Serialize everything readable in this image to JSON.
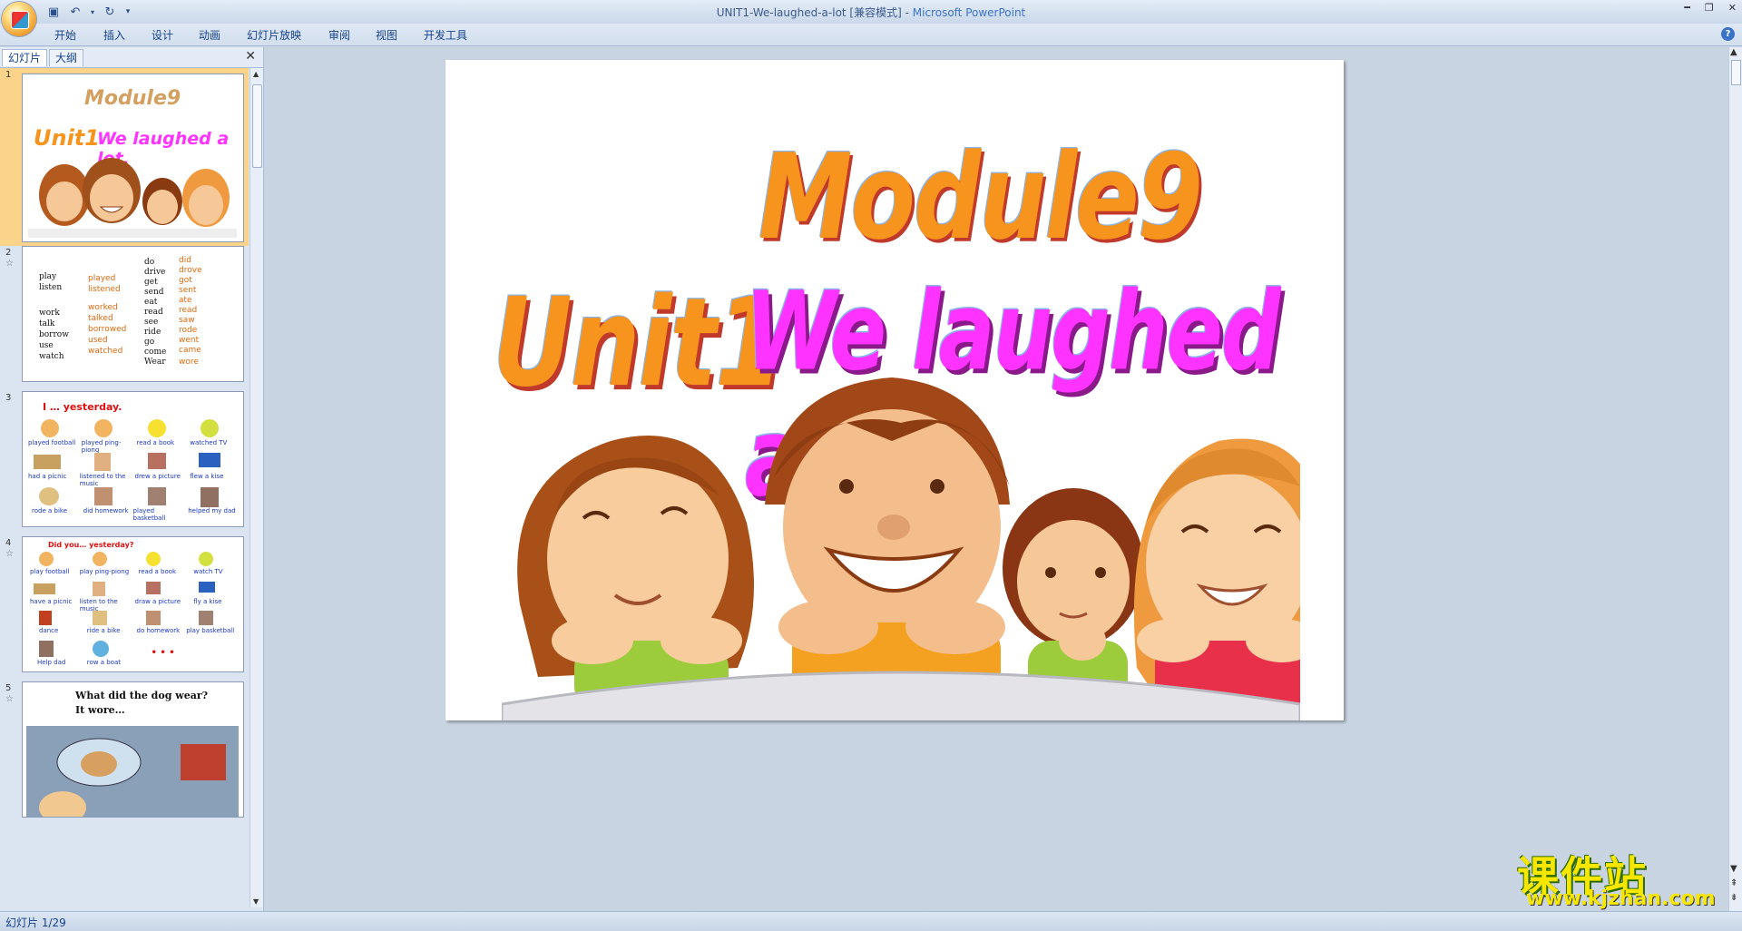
{
  "window": {
    "title_doc": "UNIT1-We-laughed-a-lot [兼容模式]",
    "title_sep": " - ",
    "title_app": "Microsoft PowerPoint"
  },
  "ribbon": {
    "tabs": [
      "开始",
      "插入",
      "设计",
      "动画",
      "幻灯片放映",
      "审阅",
      "视图",
      "开发工具"
    ]
  },
  "panel": {
    "tab_slides": "幻灯片",
    "tab_outline": "大纲",
    "close": "✕"
  },
  "thumbnails": [
    {
      "num": "1",
      "texts": {
        "module": "Module9",
        "unit": "Unit1",
        "title": "We laughed a lot."
      }
    },
    {
      "num": "2",
      "left_words": [
        "play",
        "listen",
        "work",
        "talk",
        "borrow",
        "use",
        "watch"
      ],
      "left_past": [
        "played",
        "listened",
        "worked",
        "talked",
        "borrowed",
        "used",
        "watched"
      ],
      "right_words": [
        "do",
        "drive",
        "get",
        "send",
        "eat",
        "read",
        "see",
        "ride",
        "go",
        "come",
        "Wear"
      ],
      "right_past": [
        "did",
        "drove",
        "got",
        "sent",
        "ate",
        "read",
        "saw",
        "rode",
        "went",
        "came",
        "wore"
      ]
    },
    {
      "num": "3",
      "heading": "I … yesterday.",
      "labels": [
        "played football",
        "played ping-piong",
        "read a book",
        "watched TV",
        "had a picnic",
        "listened to the music",
        "drew a picture",
        "flew a kise",
        "rode a bike",
        "did homework",
        "played basketball",
        "helped my dad"
      ]
    },
    {
      "num": "4",
      "heading": "Did you… yesterday?",
      "labels": [
        "play football",
        "play ping-piong",
        "read a book",
        "watch TV",
        "have a picnic",
        "listen to the music",
        "draw a picture",
        "fly a kise",
        "dance",
        "ride a bike",
        "do homework",
        "play basketball",
        "Help  dad",
        "row a boat",
        "• • •"
      ]
    },
    {
      "num": "5",
      "line1": "What did the dog wear?",
      "line2": "It wore…"
    }
  ],
  "slide": {
    "module": "Module9",
    "unit": "Unit1",
    "title": "We laughed a lot."
  },
  "status": {
    "slide_count": "幻灯片 1/29"
  },
  "watermark": {
    "cn": "课件站",
    "url": "www.kjzhan.com"
  },
  "colors": {
    "orange": "#f7941d",
    "magenta": "#ff33ff",
    "selection": "#fbd38a"
  }
}
